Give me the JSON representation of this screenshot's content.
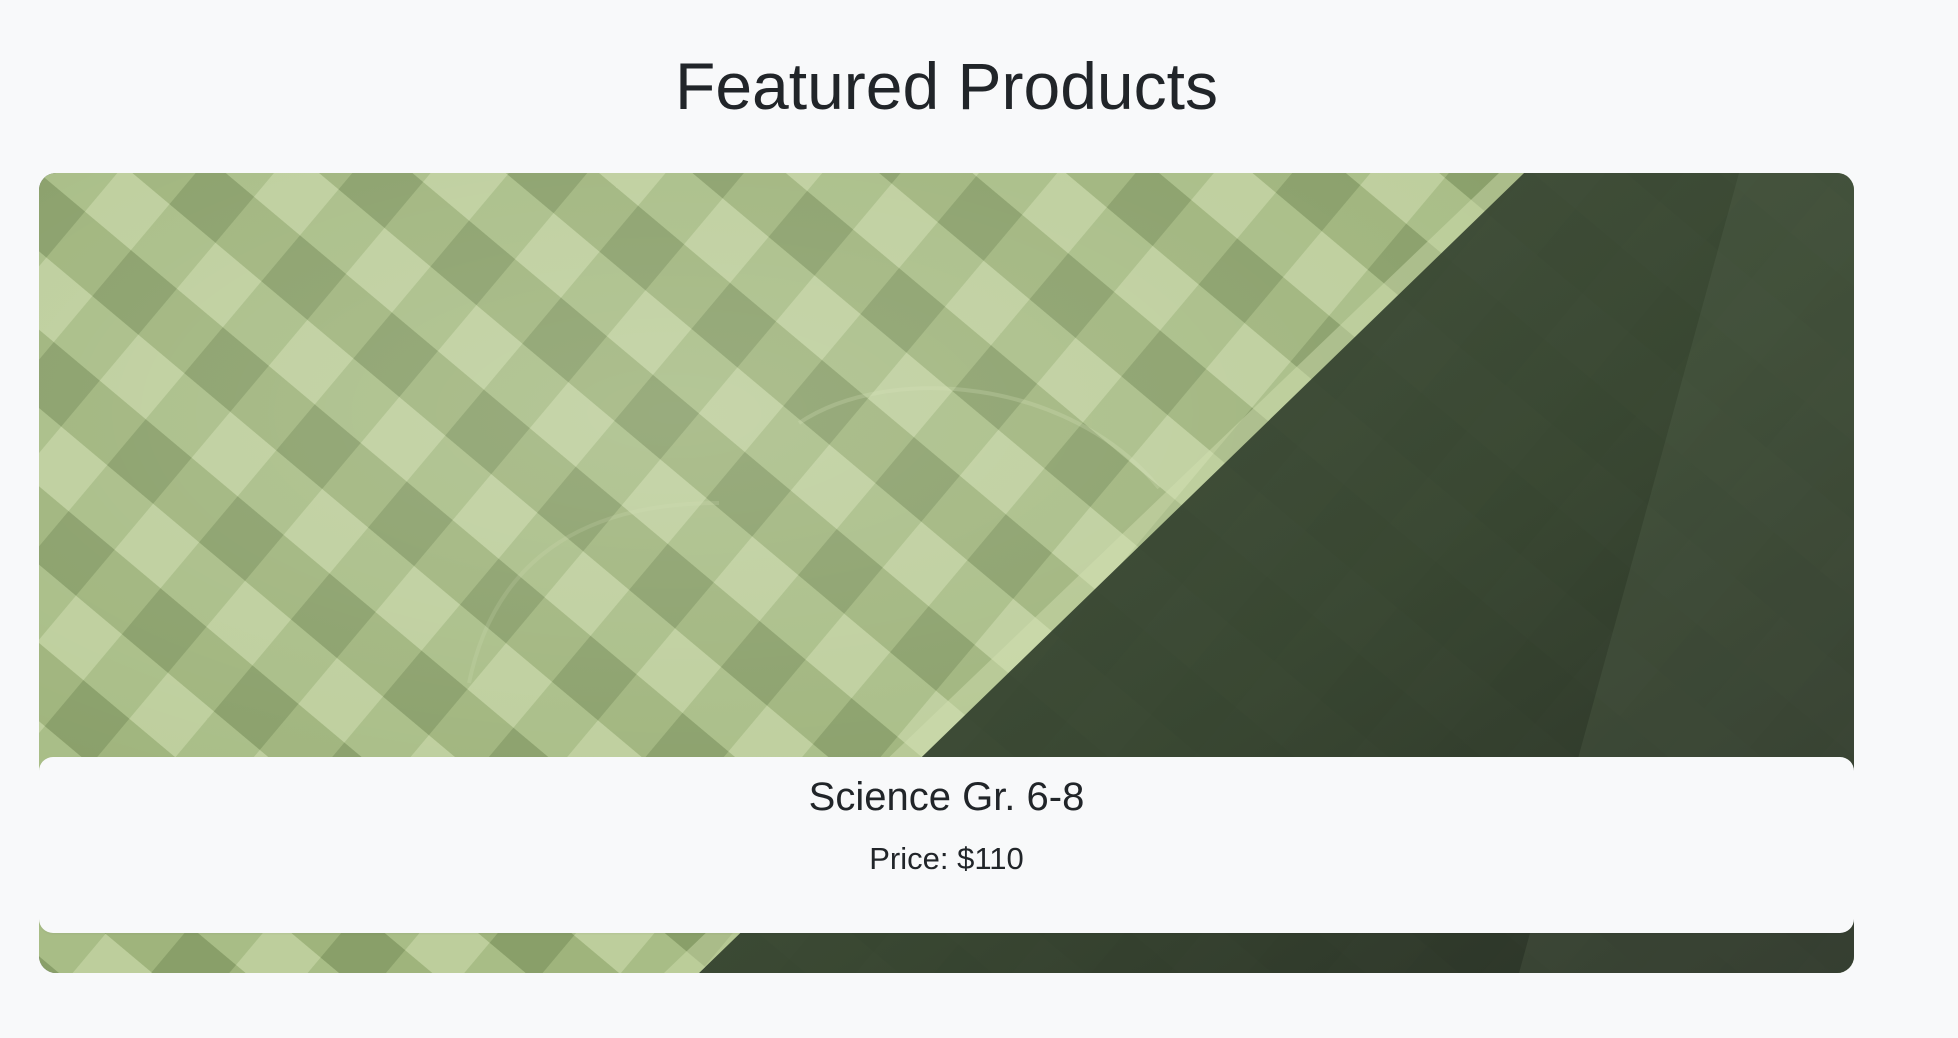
{
  "page": {
    "title": "Featured Products"
  },
  "products": [
    {
      "name": "Science Gr. 6-8",
      "price": "Price: $110",
      "image": "green-woven-pattern-product-image"
    }
  ],
  "colors": {
    "background": "#f8f9fa",
    "text": "#212529",
    "image_light_green": "#b9cb98",
    "image_mid_green": "#829563",
    "image_dark_green": "#3f4d3a"
  }
}
